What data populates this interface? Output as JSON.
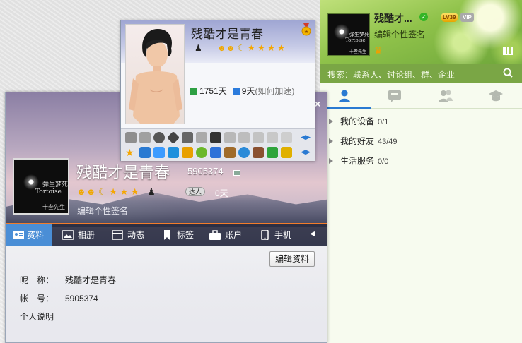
{
  "main_panel": {
    "nickname": "残酷才...",
    "level": "LV39",
    "vip": "VIP",
    "signature": "编辑个性签名",
    "search_placeholder": "搜索：联系人、讨论组、群、企业",
    "tabs": [
      "contacts",
      "messages",
      "groups",
      "apps"
    ],
    "groups": [
      {
        "name": "我的设备",
        "count": "0/1"
      },
      {
        "name": "我的好友",
        "count": "43/49"
      },
      {
        "name": "生活服务",
        "count": "0/0"
      }
    ]
  },
  "avatar": {
    "line1": "弹生梦死",
    "line2": "Tortoise",
    "line3": "十叁先生"
  },
  "profile": {
    "name": "残酷才是青春",
    "qq": "5905374",
    "vip_label": "达人",
    "days": "0天",
    "signature": "编辑个性签名",
    "close": "×",
    "tabs": [
      "资料",
      "相册",
      "动态",
      "标签",
      "账户",
      "手机"
    ],
    "edit_button": "编辑资料",
    "fields": [
      {
        "label": "昵　称：",
        "value": "残酷才是青春"
      },
      {
        "label": "帐　号：",
        "value": "5905374"
      },
      {
        "label": "个人说明",
        "value": ""
      }
    ]
  },
  "mini_card": {
    "name": "残酷才是青春",
    "active_days": "1751天",
    "speedup_days": "9天",
    "speedup_hint": "(如何加速)"
  },
  "colors": {
    "accent_green": "#7aa645",
    "tab_active_blue": "#4a8ed6",
    "tab_border_orange": "#f27c2a"
  }
}
